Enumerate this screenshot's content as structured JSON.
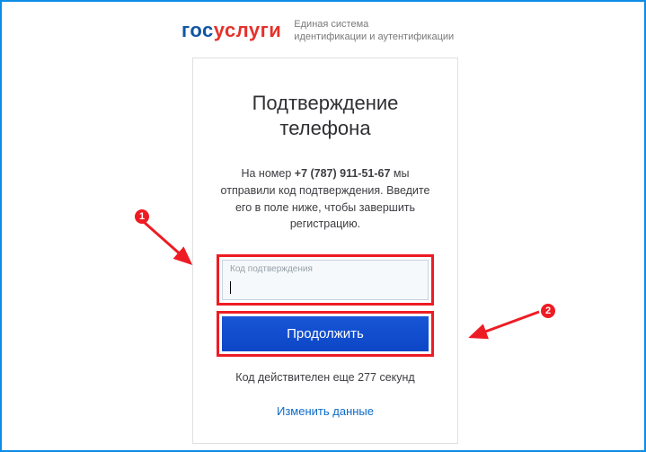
{
  "logo": {
    "part1": "гос",
    "part2": "услуги"
  },
  "header_subtitle": "Единая система\nидентификации и аутентификации",
  "card": {
    "title": "Подтверждение телефона",
    "msg_pre": "На номер ",
    "phone": "+7 (787) 911-51-67",
    "msg_post": " мы отправили код подтверждения. Введите его в поле ниже, чтобы завершить регистрацию.",
    "input_label": "Код подтверждения",
    "input_value": "",
    "button": "Продолжить",
    "timer_pre": "Код действителен еще ",
    "timer_seconds": "277",
    "timer_post": " секунд",
    "change_link": "Изменить данные"
  },
  "annotations": {
    "one": "1",
    "two": "2"
  }
}
